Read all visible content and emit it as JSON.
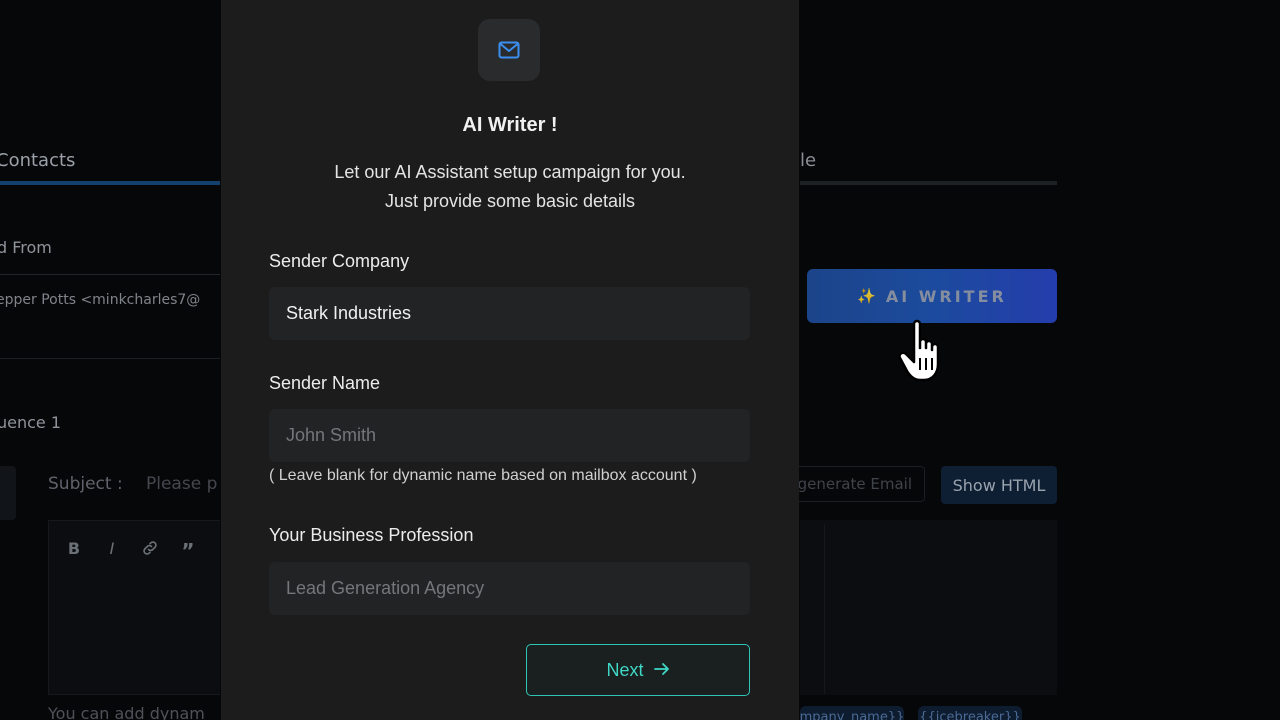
{
  "background": {
    "tab_left_label": "Contacts",
    "tab_right_label": "le",
    "send_from_label": "d From",
    "send_from_value": "epper Potts <minkcharles7@",
    "sequence_label": "uence 1",
    "subject_label": "Subject :",
    "subject_placeholder": "Please p",
    "toolbar": [
      "B",
      "I",
      "🔗",
      "”"
    ],
    "helper_text": "You can add dynam",
    "ai_writer_button": {
      "icon": "sparkle-icon",
      "label": "AI WRITER"
    },
    "regenerate_label": "generate Email",
    "show_html_label": "Show HTML",
    "chips": [
      "mpany_name}}",
      "{{icebreaker}}"
    ]
  },
  "modal": {
    "icon": "mail-icon",
    "title": "AI Writer !",
    "subtitle_line1": "Let our AI Assistant setup campaign for you.",
    "subtitle_line2": "Just provide some basic details",
    "sender_company": {
      "label": "Sender Company",
      "value": "Stark Industries"
    },
    "sender_name": {
      "label": "Sender Name",
      "placeholder": "John Smith",
      "hint": "( Leave blank for dynamic name based on mailbox account )"
    },
    "business_profession": {
      "label": "Your Business Profession",
      "placeholder": "Lead Generation Agency"
    },
    "next_button": {
      "label": "Next",
      "icon": "arrow-right-icon"
    }
  },
  "colors": {
    "accent_teal": "#2fc5b5",
    "ai_writer_gradient_start": "#1f4fa0",
    "ai_writer_gradient_end": "#2a46c9",
    "modal_bg": "#1c1c1d"
  }
}
